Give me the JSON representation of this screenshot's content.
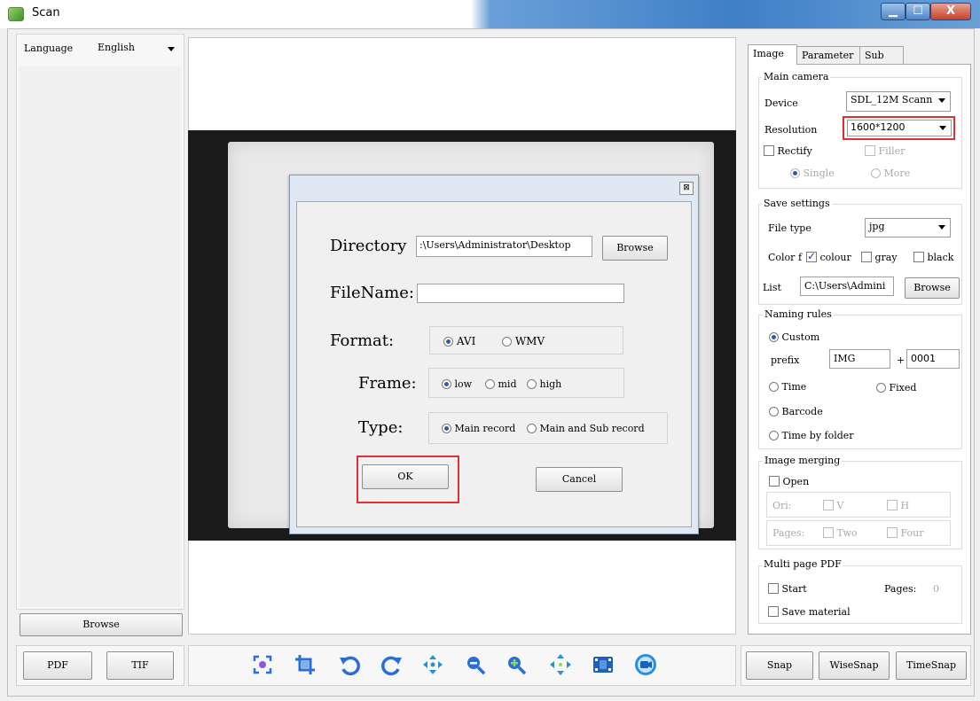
{
  "window": {
    "title": "Scan",
    "min_glyph": "▁",
    "max_glyph": "☐",
    "close_glyph": "X"
  },
  "left": {
    "language_label": "Language",
    "language_value": "English",
    "browse_label": "Browse",
    "pdf_label": "PDF",
    "tif_label": "TIF"
  },
  "dialog": {
    "close_glyph": "⊠",
    "directory_label": "Directory",
    "directory_value": ":\\Users\\Administrator\\Desktop",
    "browse_label": "Browse",
    "filename_label": "FileName:",
    "filename_value": "",
    "format_label": "Format:",
    "format_options": [
      "AVI",
      "WMV"
    ],
    "frame_label": "Frame:",
    "frame_options": [
      "low",
      "mid",
      "high"
    ],
    "type_label": "Type:",
    "type_options": [
      "Main record",
      "Main and Sub record"
    ],
    "ok_label": "OK",
    "cancel_label": "Cancel"
  },
  "tabs": [
    "Image",
    "Parameter",
    "Sub"
  ],
  "right": {
    "main_camera": {
      "title": "Main camera",
      "device_label": "Device",
      "device_value": "SDL_12M Scann",
      "resolution_label": "Resolution",
      "resolution_value": "1600*1200",
      "rectify_label": "Rectify",
      "filler_label": "Filler",
      "single_label": "Single",
      "more_label": "More"
    },
    "save_settings": {
      "title": "Save settings",
      "file_type_label": "File type",
      "file_type_value": "jpg",
      "color_label": "Color",
      "color_prefix": "f",
      "colour_label": "colour",
      "gray_label": "gray",
      "black_label": "black",
      "list_label": "List",
      "list_value": "C:\\Users\\Admini",
      "browse_label": "Browse"
    },
    "naming_rules": {
      "title": "Naming rules",
      "custom_label": "Custom",
      "prefix_label": "prefix",
      "prefix_value": "IMG",
      "plus": "+",
      "number_value": "0001",
      "time_label": "Time",
      "fixed_label": "Fixed",
      "barcode_label": "Barcode",
      "time_by_folder_label": "Time by folder"
    },
    "image_merging": {
      "title": "Image merging",
      "open_label": "Open",
      "ori_label": "Ori:",
      "v_label": "V",
      "h_label": "H",
      "pages_label": "Pages:",
      "two_label": "Two",
      "four_label": "Four"
    },
    "multi_page_pdf": {
      "title": "Multi page PDF",
      "start_label": "Start",
      "pages_label": "Pages:",
      "pages_value": "0",
      "save_material_label": "Save material"
    }
  },
  "bottom": {
    "snap_label": "Snap",
    "wisesnap_label": "WiseSnap",
    "timesnap_label": "TimeSnap"
  },
  "icons": [
    "focus-icon",
    "crop-icon",
    "rotate-left-icon",
    "rotate-right-icon",
    "move-icon",
    "zoom-out-icon",
    "zoom-in-icon",
    "expand-icon",
    "film-icon",
    "record-icon"
  ]
}
